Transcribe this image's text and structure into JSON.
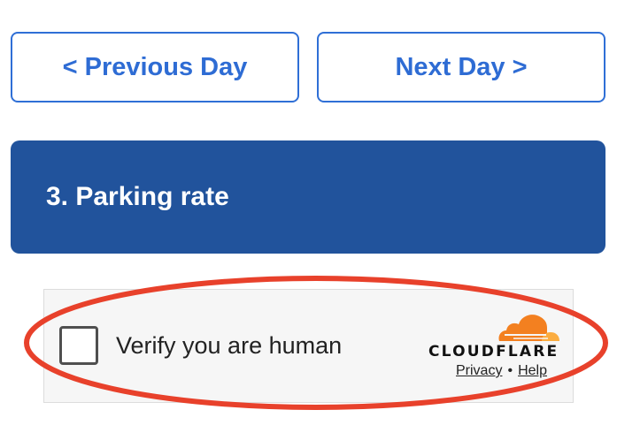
{
  "navigation": {
    "previous_label": "< Previous Day",
    "next_label": "Next Day >"
  },
  "section": {
    "title": "3. Parking rate"
  },
  "captcha": {
    "label": "Verify you are human",
    "brand": "CLOUDFLARE",
    "privacy_label": "Privacy",
    "separator": "•",
    "help_label": "Help"
  },
  "colors": {
    "accent_blue": "#2e6cd4",
    "header_blue": "#21539c",
    "highlight_red": "#e8412b",
    "cloudflare_orange": "#f38020"
  }
}
